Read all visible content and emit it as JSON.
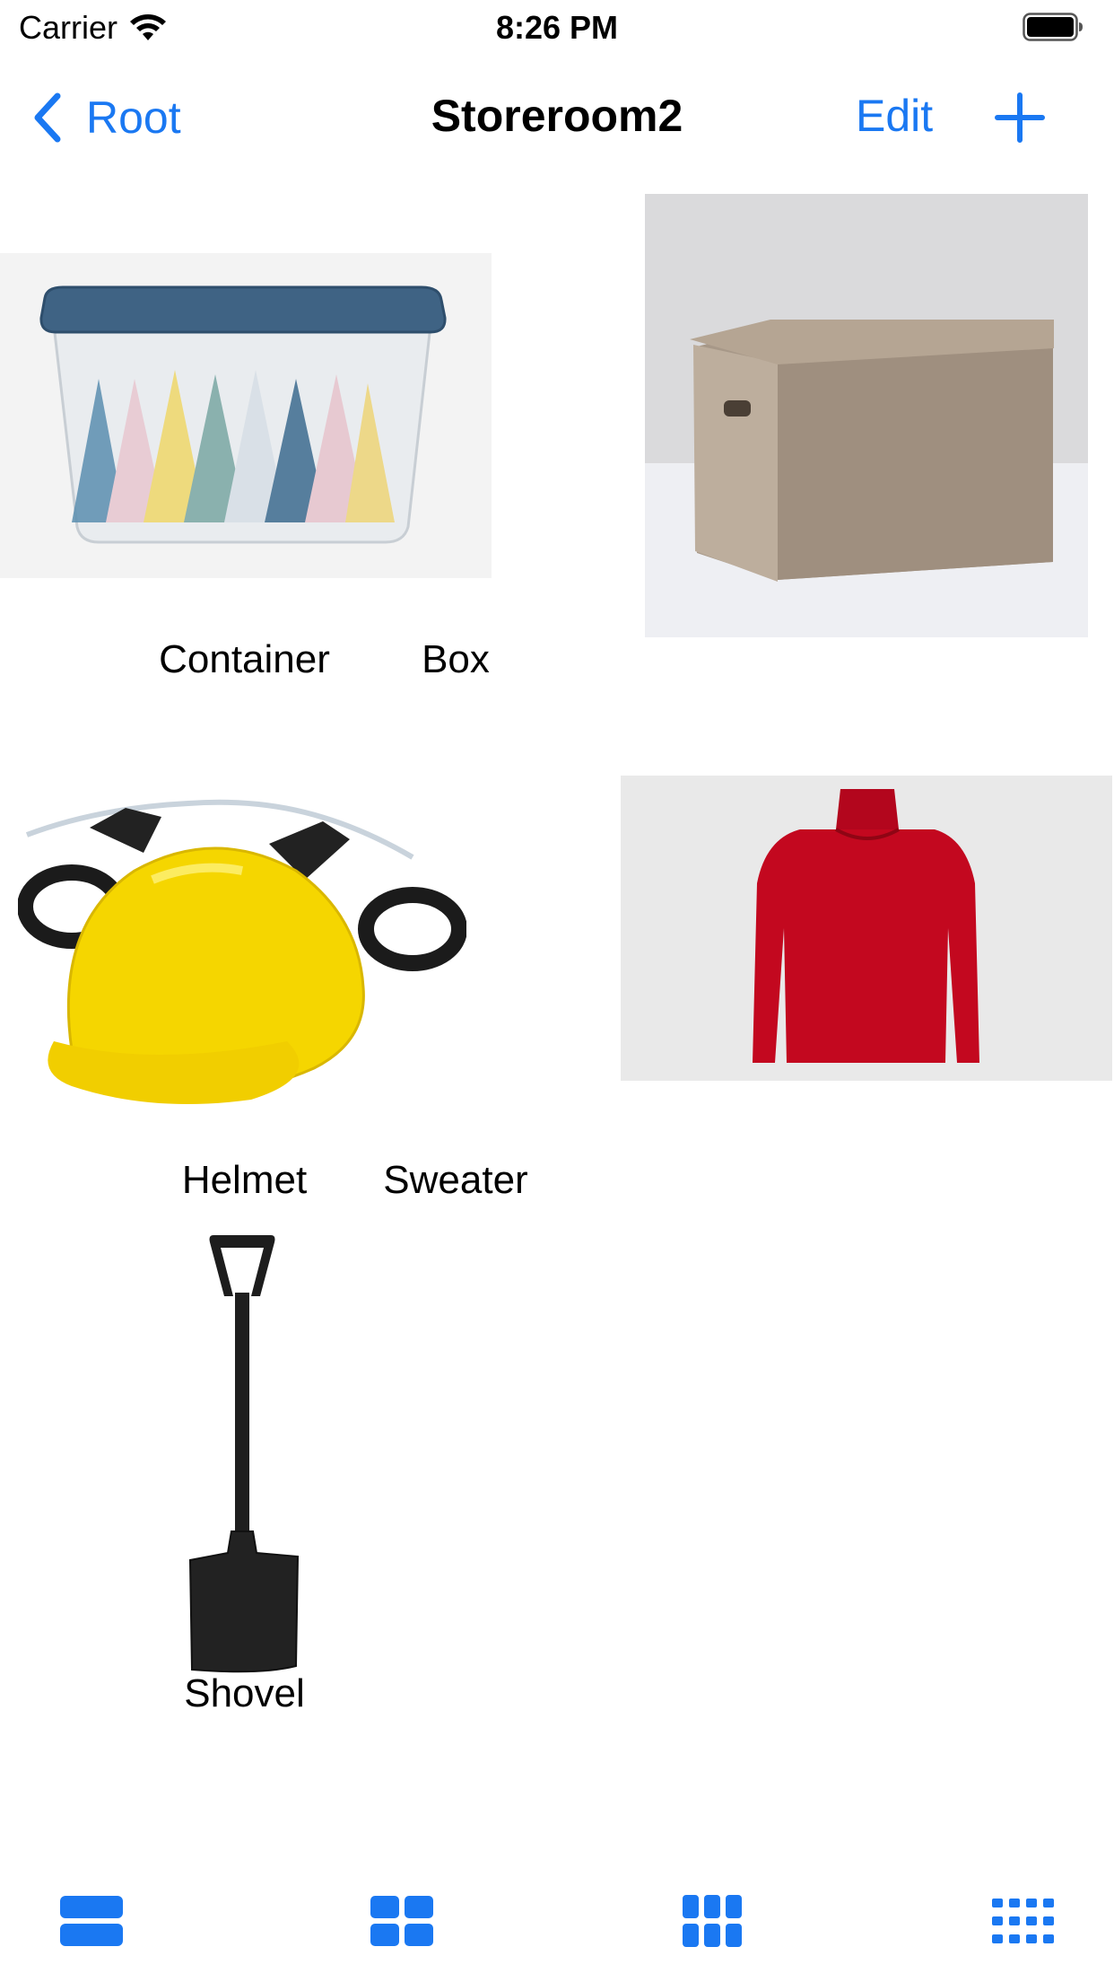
{
  "status_bar": {
    "carrier": "Carrier",
    "time": "8:26 PM",
    "wifi_icon": "wifi-icon",
    "battery_icon": "battery-full-icon"
  },
  "nav": {
    "back_label": "Root",
    "back_icon": "chevron-left-icon",
    "title": "Storeroom2",
    "edit_label": "Edit",
    "add_icon": "plus-icon"
  },
  "items": [
    {
      "name": "Container",
      "image": "plastic-storage-container-image"
    },
    {
      "name": "Box",
      "image": "cardboard-box-image"
    },
    {
      "name": "Helmet",
      "image": "yellow-drinking-helmet-image"
    },
    {
      "name": "Sweater",
      "image": "red-turtleneck-sweater-image"
    },
    {
      "name": "Shovel",
      "image": "shovel-image"
    }
  ],
  "toolbar": {
    "buttons": [
      {
        "icon": "grid-1-column-icon"
      },
      {
        "icon": "grid-2-column-icon"
      },
      {
        "icon": "grid-3-column-icon"
      },
      {
        "icon": "grid-4-column-icon"
      }
    ]
  },
  "colors": {
    "accent": "#1a78f2",
    "background": "#ffffff",
    "text": "#000000"
  }
}
